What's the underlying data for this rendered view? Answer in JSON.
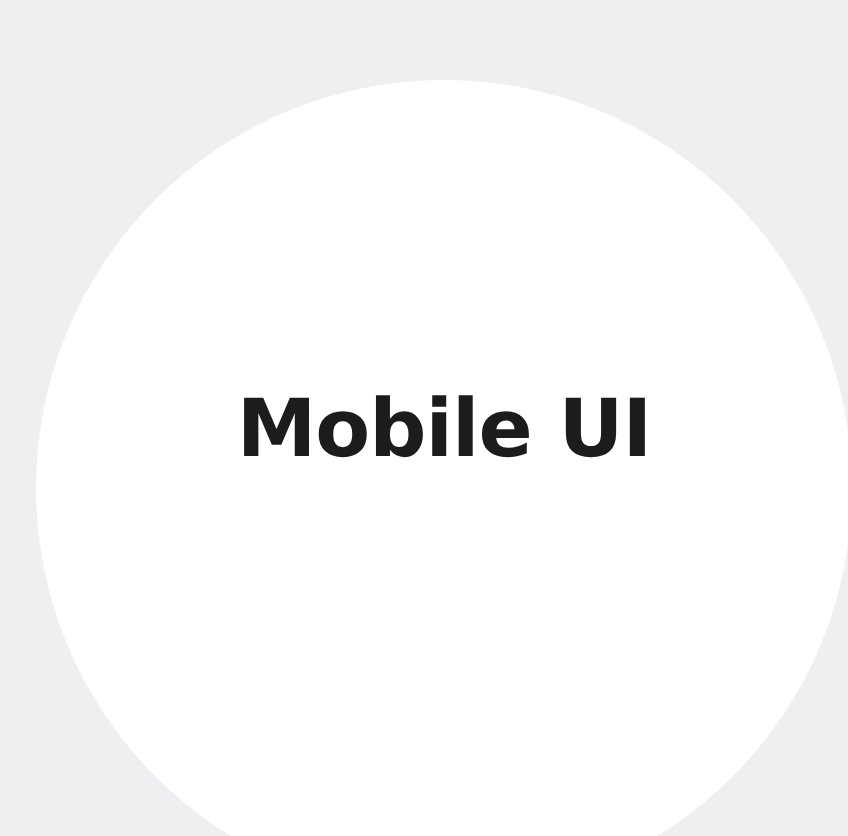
{
  "card": {
    "title": "Mobile UI"
  }
}
